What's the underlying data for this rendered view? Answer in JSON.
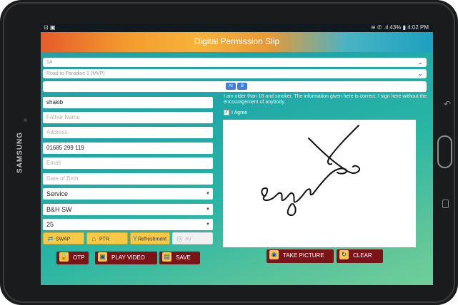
{
  "device": {
    "brand": "SAMSUNG"
  },
  "status_bar": {
    "left_icons": "⊡ ▣",
    "right_text": "≋ ✆ .ıl 43% ▮ 4:02 PM"
  },
  "app": {
    "title": "Digital Permission Slip"
  },
  "selectors": {
    "class_value": "1A",
    "journey_value": "Road to Paradise 1 (MVP)",
    "toggle_a": "AI",
    "toggle_b": "B"
  },
  "form": {
    "name_value": "shakib",
    "father_name_placeholder": "Father Name",
    "address_placeholder": "Address",
    "phone_value": "01685 299 119",
    "email_placeholder": "Email",
    "dob_placeholder": "Date of Birth",
    "service_value": "Service",
    "branch_value": "B&H SW",
    "number_value": "25"
  },
  "small_buttons": {
    "swap": "SWAP",
    "ptr": "PTR",
    "refreshment": "Refreshment",
    "av": "AV"
  },
  "action_buttons": {
    "otp": "OTP",
    "play_video": "PLAY VIDEO",
    "save": "SAVE",
    "take_picture": "TAKE PICTURE",
    "clear": "CLEAR"
  },
  "consent": {
    "text": "I am older than 18 and smoker. The information given here is correct. I sign here without the encouragement of anybody.",
    "agree_label": "I Agree",
    "agree_checked": true
  },
  "colors": {
    "title_gradient_start": "#e65b2a",
    "title_gradient_end": "#1da0bf",
    "button_dark_red": "#7a1418",
    "button_yellow": "#f7c948",
    "screen_bg": "#1fa7a8"
  },
  "icons": {
    "swap": "swap-icon",
    "ptr": "home-icon",
    "refreshment": "cocktail-icon",
    "av": "disc-icon",
    "otp": "lock-icon",
    "play_video": "video-icon",
    "save": "floppy-icon",
    "take_picture": "camera-icon",
    "clear": "refresh-icon"
  }
}
